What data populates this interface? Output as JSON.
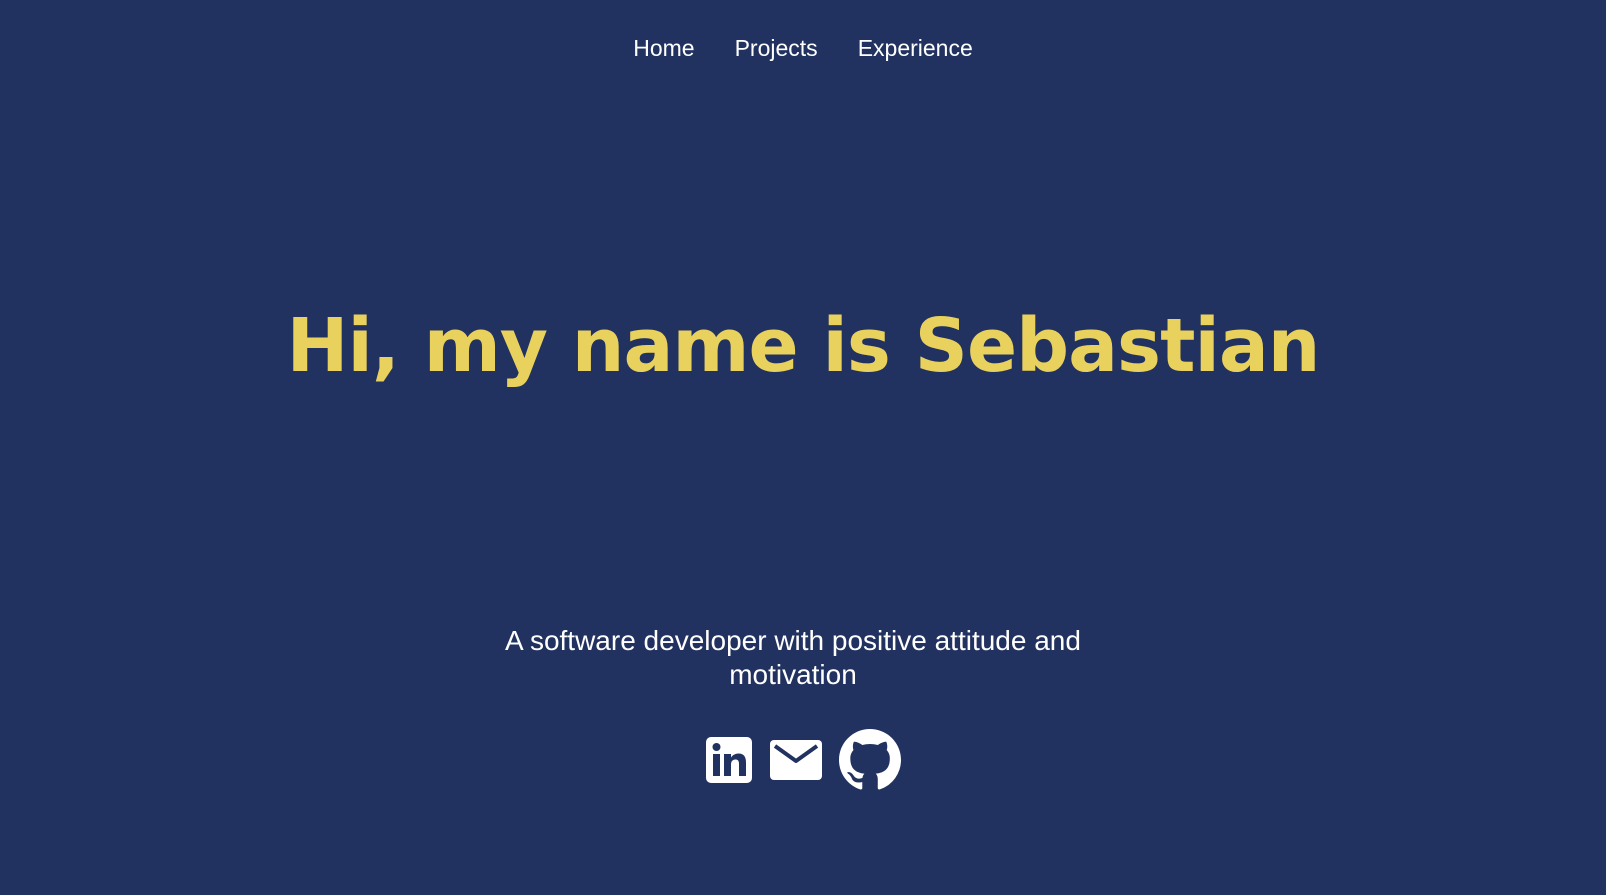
{
  "nav": {
    "items": [
      {
        "label": "Home"
      },
      {
        "label": "Projects"
      },
      {
        "label": "Experience"
      }
    ]
  },
  "hero": {
    "title": "Hi, my name is Sebastian",
    "subtitle": "A software developer with positive attitude and motivation"
  },
  "socials": [
    {
      "icon": "linkedin-icon"
    },
    {
      "icon": "mail-icon"
    },
    {
      "icon": "github-icon"
    }
  ],
  "colors": {
    "background": "#223260",
    "accent": "#e9d15e",
    "text": "#ffffff"
  }
}
